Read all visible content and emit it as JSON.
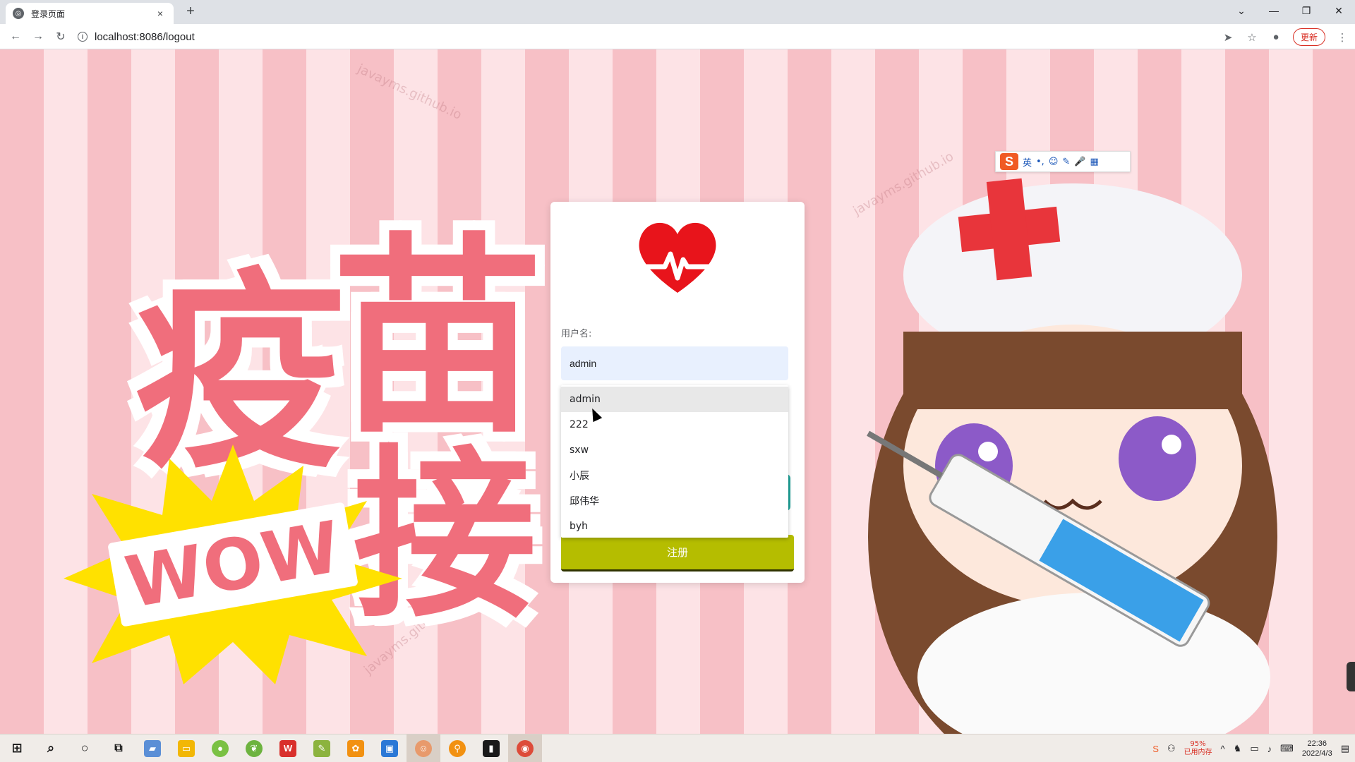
{
  "browser": {
    "tab_title": "登录页面",
    "tab_close": "×",
    "new_tab": "+",
    "url": "localhost:8086/logout",
    "update_label": "更新",
    "window_controls": [
      "⌄",
      "—",
      "❐",
      "✕"
    ]
  },
  "page": {
    "watermark": "javayms.github.io",
    "headline_chars": [
      "疫",
      "苗",
      "接"
    ],
    "burst_text": "WOW"
  },
  "ime": {
    "items": [
      "英",
      "•,",
      "☺",
      "✎",
      "🎤",
      "▦"
    ]
  },
  "login": {
    "username_label": "用户名:",
    "username_value": "admin",
    "register_label": "注册",
    "autocomplete": [
      "admin",
      "222",
      "sxw",
      "小辰",
      "邱伟华",
      "byh"
    ]
  },
  "taskbar": {
    "memory_percent": "95%",
    "memory_label": "已用内存",
    "time": "22:36",
    "date": "2022/4/3",
    "apps": [
      {
        "icon": "windows-start-icon",
        "color": "#1a1a1a"
      },
      {
        "icon": "search-icon",
        "color": "#1a1a1a"
      },
      {
        "icon": "cortana-icon",
        "color": "#1a1a1a"
      },
      {
        "icon": "task-view-icon",
        "color": "#1a1a1a"
      },
      {
        "icon": "app-icon",
        "color": "#5b8fd6"
      },
      {
        "icon": "file-explorer-icon",
        "color": "#f2b705"
      },
      {
        "icon": "app-icon",
        "color": "#7ac143"
      },
      {
        "icon": "spring-icon",
        "color": "#6db33f"
      },
      {
        "icon": "wps-icon",
        "color": "#d9302c"
      },
      {
        "icon": "notepad-icon",
        "color": "#8cb33e"
      },
      {
        "icon": "app-icon",
        "color": "#f29111"
      },
      {
        "icon": "app-icon",
        "color": "#2b78d6"
      },
      {
        "icon": "app-icon",
        "color": "#e89a6c"
      },
      {
        "icon": "search-app-icon",
        "color": "#f29111"
      },
      {
        "icon": "terminal-icon",
        "color": "#1a1a1a"
      },
      {
        "icon": "chrome-icon",
        "color": "#dd4b39"
      }
    ]
  },
  "colors": {
    "stripe_dark": "#f7c0c6",
    "stripe_light": "#fde3e6",
    "headline": "#f06e7c",
    "register_button": "#b5bd00",
    "input_bg": "#e8f0fe"
  }
}
